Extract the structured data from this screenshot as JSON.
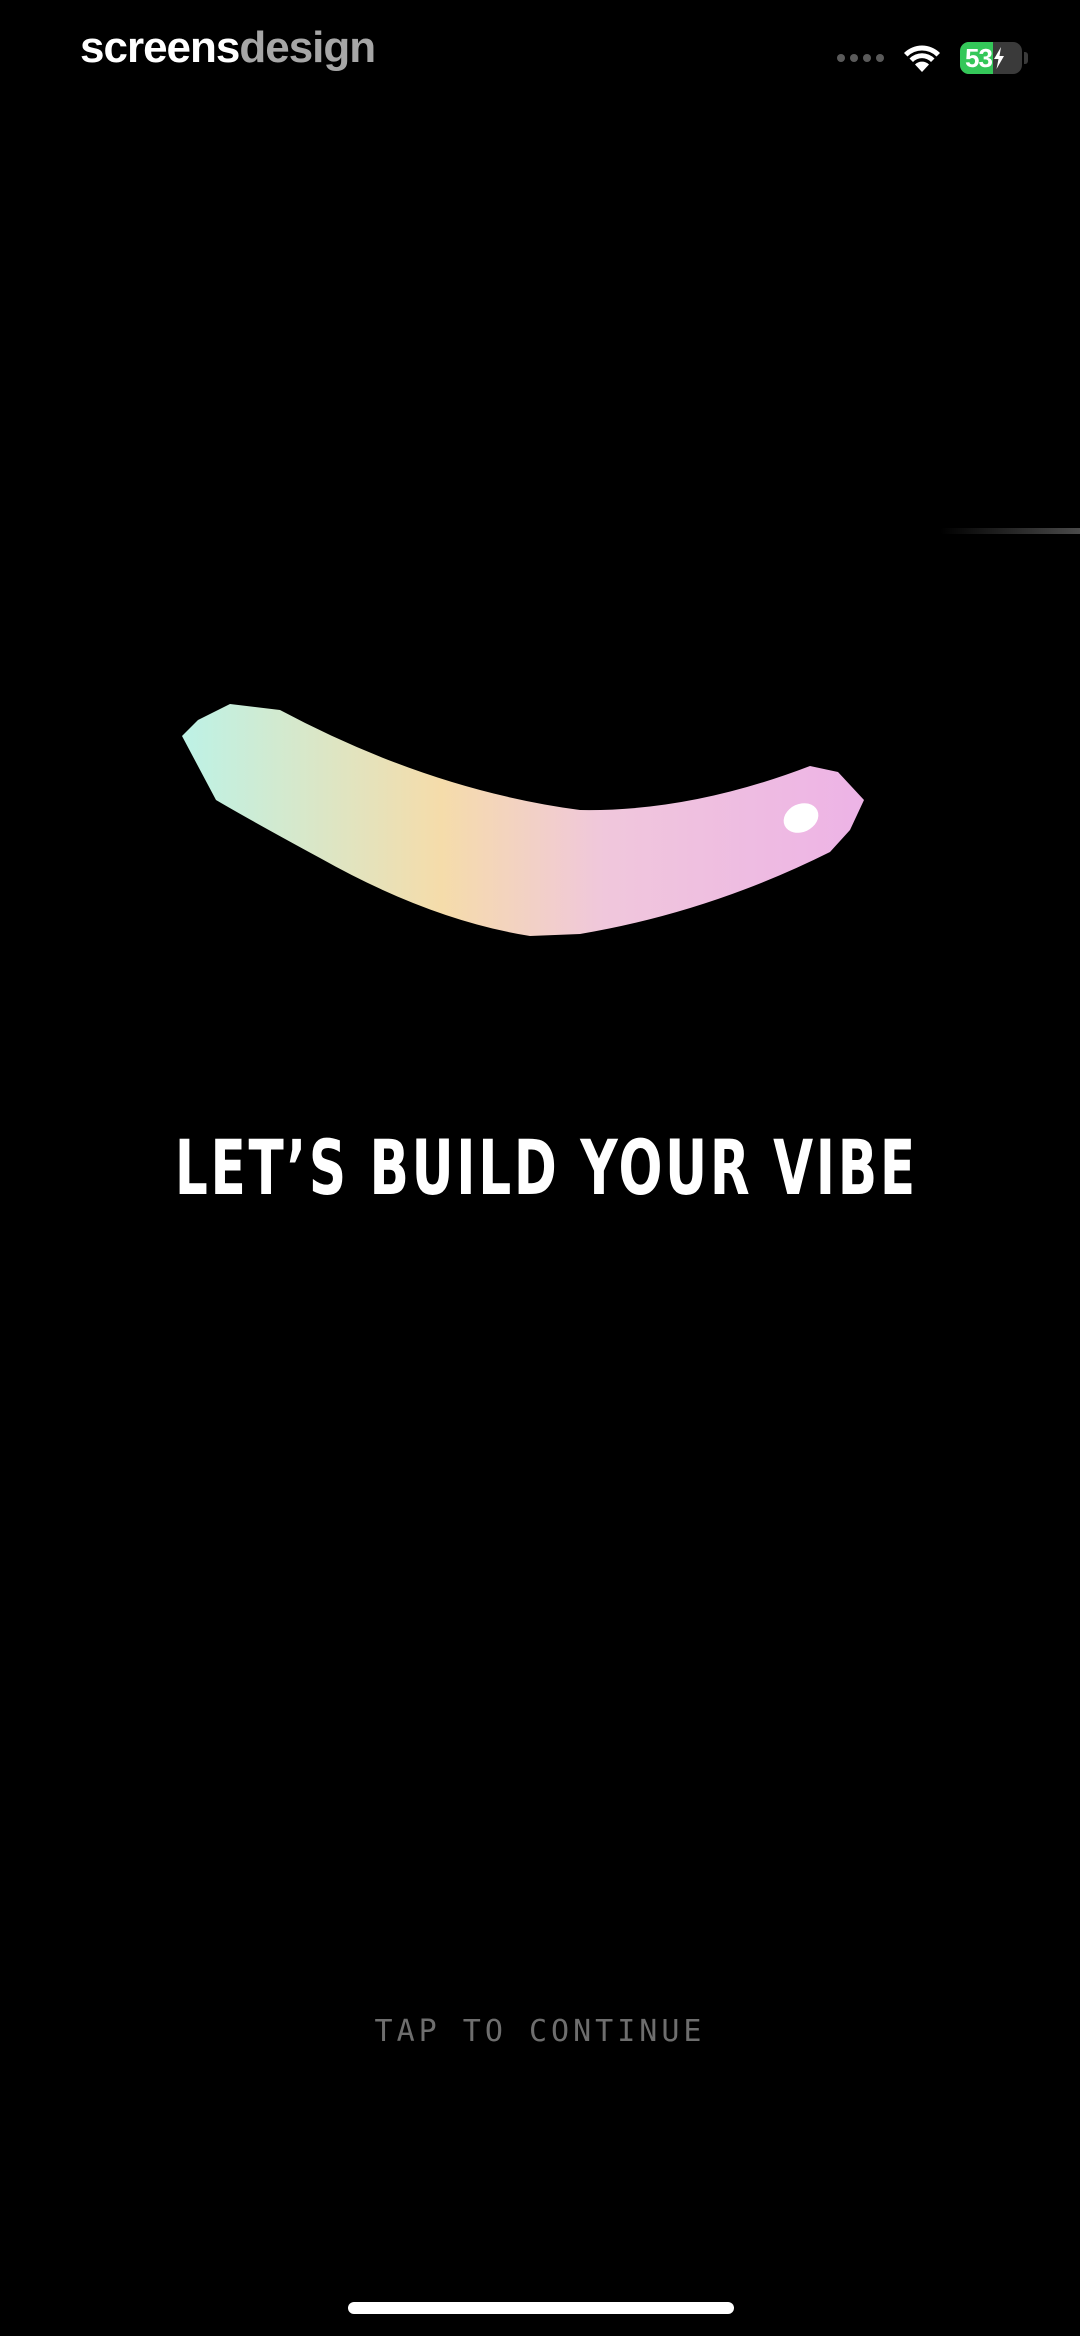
{
  "watermark": {
    "part1": "screens",
    "part2": "design"
  },
  "status_bar": {
    "battery_percent": "53",
    "battery_level": 0.53,
    "charging": true,
    "battery_color": "#34c759",
    "icons": [
      "signal-dots-icon",
      "wifi-icon",
      "battery-icon",
      "charging-bolt-icon"
    ]
  },
  "onboarding": {
    "headline": "LET’S BUILD YOUR VIBE",
    "cta": "TAP TO CONTINUE",
    "wave_gradient": [
      "#bdf2e6",
      "#f5dcaa",
      "#f0c7dc",
      "#edb3e6"
    ]
  }
}
